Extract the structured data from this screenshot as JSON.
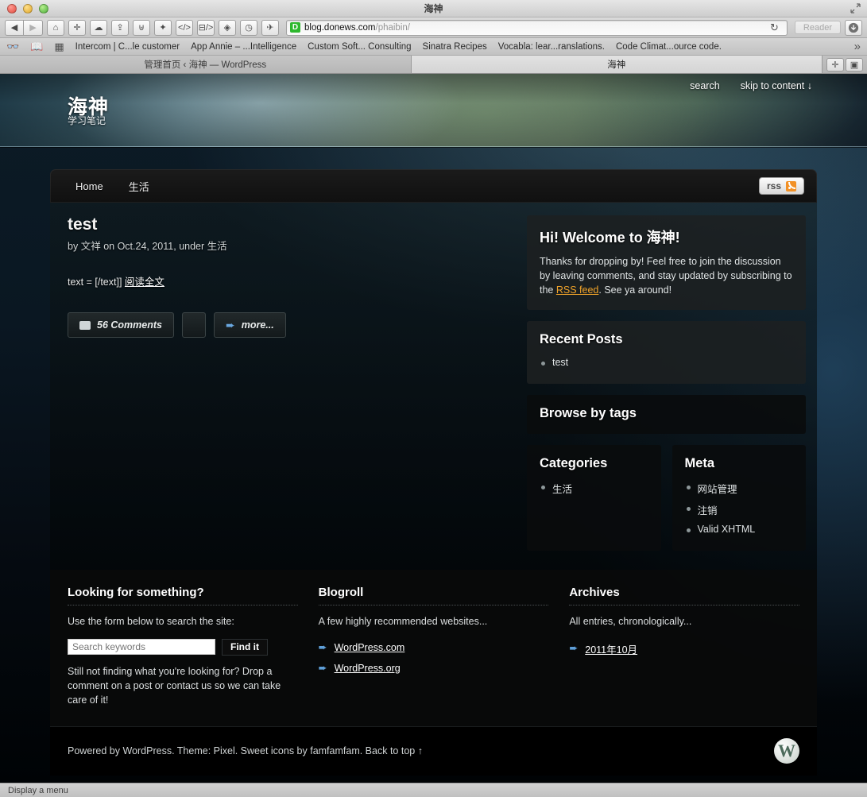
{
  "browser": {
    "window_title": "海神",
    "toolbar_icons": [
      "back-icon",
      "forward-icon",
      "home-icon",
      "add-tab-icon",
      "icloud-icon",
      "share-icon",
      "evernote-icon",
      "pinboard-icon",
      "code-icon",
      "instapaper-icon",
      "ink-icon",
      "clock-icon",
      "bug-icon"
    ],
    "url_host": "blog.donews.com",
    "url_path": "/phaibin/",
    "favicon_letter": "D",
    "reload_label": "↻",
    "reader_label": "Reader",
    "download_icon": "download-icon",
    "bookmarks": [
      "Intercom | C...le customer",
      "App Annie – ...Intelligence",
      "Custom Soft... Consulting",
      "Sinatra Recipes",
      "Vocabla: lear...ranslations.",
      "Code Climat...ource code."
    ],
    "bookmarks_overflow": "»",
    "tabs": [
      {
        "label": "管理首页 ‹ 海神 — WordPress",
        "active": false
      },
      {
        "label": "海神",
        "active": true
      }
    ],
    "tab_tools": [
      "new-tab-icon",
      "tab-overview-icon"
    ],
    "status_text": "Display a menu"
  },
  "site": {
    "title": "海神",
    "tagline": "学习笔记",
    "header_links": [
      {
        "label": "search"
      },
      {
        "label": "skip to content ↓"
      }
    ],
    "nav": [
      {
        "label": "Home"
      },
      {
        "label": "生活"
      }
    ],
    "rss_label": "rss"
  },
  "post": {
    "title": "test",
    "meta_by": "by",
    "meta_author": "文祥",
    "meta_on": "on",
    "meta_date": "Oct.24, 2011,",
    "meta_under": "under",
    "meta_category": "生活",
    "body_text": "text = [/text]]",
    "read_more_link": "阅读全文",
    "comments_label": "56 Comments",
    "more_label": "more..."
  },
  "sidebar": {
    "welcome": {
      "title": "Hi! Welcome to 海神!",
      "text_a": "Thanks for dropping by! Feel free to join the discussion by leaving comments, and stay updated by subscribing to the ",
      "link": "RSS feed",
      "text_b": ". See ya around!"
    },
    "recent_posts": {
      "title": "Recent Posts",
      "items": [
        "test"
      ]
    },
    "tags": {
      "title": "Browse by tags"
    },
    "categories": {
      "title": "Categories",
      "items": [
        "生活"
      ]
    },
    "meta": {
      "title": "Meta",
      "items": [
        "网站管理",
        "注销",
        "Valid XHTML"
      ]
    }
  },
  "footer_widgets": {
    "search": {
      "title": "Looking for something?",
      "intro": "Use the form below to search the site:",
      "placeholder": "Search keywords",
      "button": "Find it",
      "note": "Still not finding what you're looking for? Drop a comment on a post or contact us so we can take care of it!"
    },
    "blogroll": {
      "title": "Blogroll",
      "intro": "A few highly recommended websites...",
      "links": [
        "WordPress.com",
        "WordPress.org"
      ]
    },
    "archives": {
      "title": "Archives",
      "intro": "All entries, chronologically...",
      "links": [
        "2011年10月"
      ]
    }
  },
  "footer": {
    "credit": "Powered by WordPress. Theme: Pixel. Sweet icons by famfamfam. Back to top ↑",
    "badge_letter": "W"
  },
  "colors": {
    "accent_orange": "#f0a32a",
    "link_blue": "#5f9fd8",
    "rss_orange": "#f29126"
  }
}
